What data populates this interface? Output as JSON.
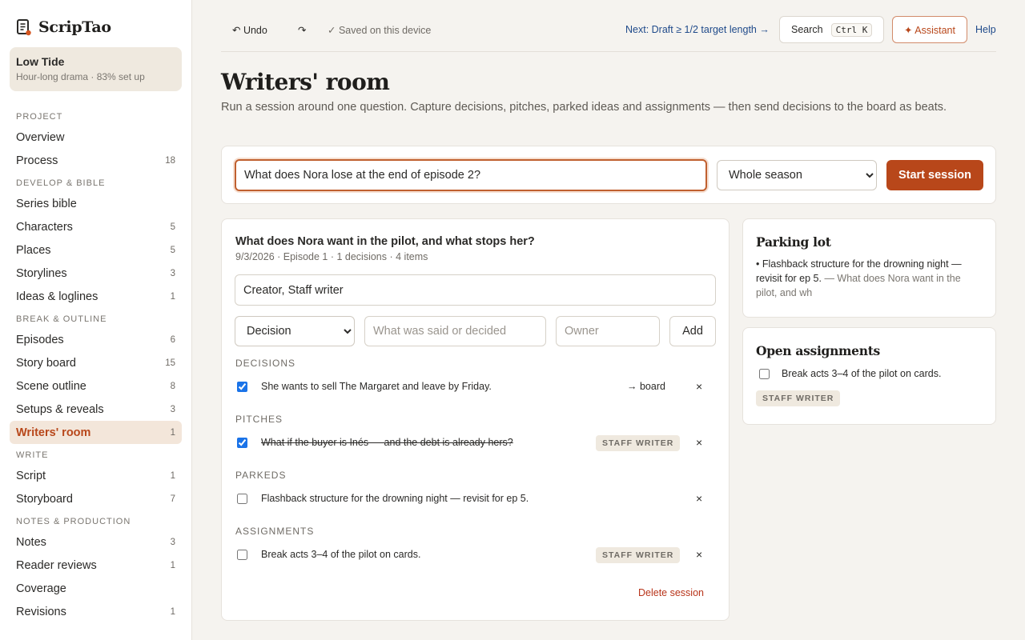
{
  "brand": {
    "name": "ScripTao",
    "icon": "script-logo-icon"
  },
  "project": {
    "name": "Low Tide",
    "meta": "Hour-long drama · 83% set up"
  },
  "sidebar": {
    "sections": [
      {
        "label": "PROJECT",
        "items": [
          {
            "label": "Overview",
            "count": ""
          },
          {
            "label": "Process",
            "count": "18"
          }
        ]
      },
      {
        "label": "DEVELOP & BIBLE",
        "items": [
          {
            "label": "Series bible",
            "count": ""
          },
          {
            "label": "Characters",
            "count": "5"
          },
          {
            "label": "Places",
            "count": "5"
          },
          {
            "label": "Storylines",
            "count": "3"
          },
          {
            "label": "Ideas & loglines",
            "count": "1"
          }
        ]
      },
      {
        "label": "BREAK & OUTLINE",
        "items": [
          {
            "label": "Episodes",
            "count": "6"
          },
          {
            "label": "Story board",
            "count": "15"
          },
          {
            "label": "Scene outline",
            "count": "8"
          },
          {
            "label": "Setups & reveals",
            "count": "3"
          },
          {
            "label": "Writers' room",
            "count": "1",
            "active": true
          }
        ]
      },
      {
        "label": "WRITE",
        "items": [
          {
            "label": "Script",
            "count": "1"
          },
          {
            "label": "Storyboard",
            "count": "7"
          }
        ]
      },
      {
        "label": "NOTES & PRODUCTION",
        "items": [
          {
            "label": "Notes",
            "count": "3"
          },
          {
            "label": "Reader reviews",
            "count": "1"
          },
          {
            "label": "Coverage",
            "count": ""
          },
          {
            "label": "Revisions",
            "count": "1"
          }
        ]
      }
    ]
  },
  "toolbar": {
    "undo": "↶ Undo",
    "redo": "↷",
    "saved": "✓ Saved on this device",
    "next": "Next: Draft ≥ 1/2 target length →",
    "search": "Search",
    "search_kbd": "Ctrl K",
    "assistant": "✦ Assistant",
    "help": "Help"
  },
  "page": {
    "title": "Writers' room",
    "subtitle": "Run a session around one question. Capture decisions, pitches, parked ideas and assignments — then send decisions to the board as beats."
  },
  "session_bar": {
    "question_value": "What does Nora lose at the end of episode 2?",
    "scope_selected": "Whole season",
    "start_label": "Start session"
  },
  "session": {
    "title": "What does Nora want in the pilot, and what stops her?",
    "meta": "9/3/2026 · Episode 1 · 1 decisions · 4 items",
    "participants_value": "Creator, Staff writer",
    "type_selected": "Decision",
    "said_placeholder": "What was said or decided",
    "owner_placeholder": "Owner",
    "add_label": "Add",
    "groups": {
      "decisions": {
        "label": "DECISIONS",
        "text": "She wants to sell The Margaret and leave by Friday.",
        "action": "→ board",
        "checked": true
      },
      "pitches": {
        "label": "PITCHS",
        "display_label": "PITCHES",
        "text": "What if the buyer is Inés — and the debt is already hers?",
        "owner": "STAFF WRITER",
        "checked": true
      },
      "parkeds": {
        "label": "PARKEDS",
        "text": "Flashback structure for the drowning night — revisit for ep 5.",
        "checked": false
      },
      "assignments": {
        "label": "ASSIGNMENTS",
        "text": "Break acts 3–4 of the pilot on cards.",
        "owner": "STAFF WRITER",
        "checked": false
      }
    },
    "remove_glyph": "×",
    "delete_label": "Delete session"
  },
  "parking_lot": {
    "title": "Parking lot",
    "item": "• Flashback structure for the drowning night — revisit for ep 5.",
    "source": " — What does Nora want in the pilot, and wh"
  },
  "open_assignments": {
    "title": "Open assignments",
    "item": "Break acts 3–4 of the pilot on cards.",
    "owner": "STAFF WRITER"
  },
  "colors": {
    "accent": "#b8471a",
    "link": "#1f4a8a",
    "background": "#f5f3ef",
    "active_nav_bg": "#f3e6da"
  }
}
